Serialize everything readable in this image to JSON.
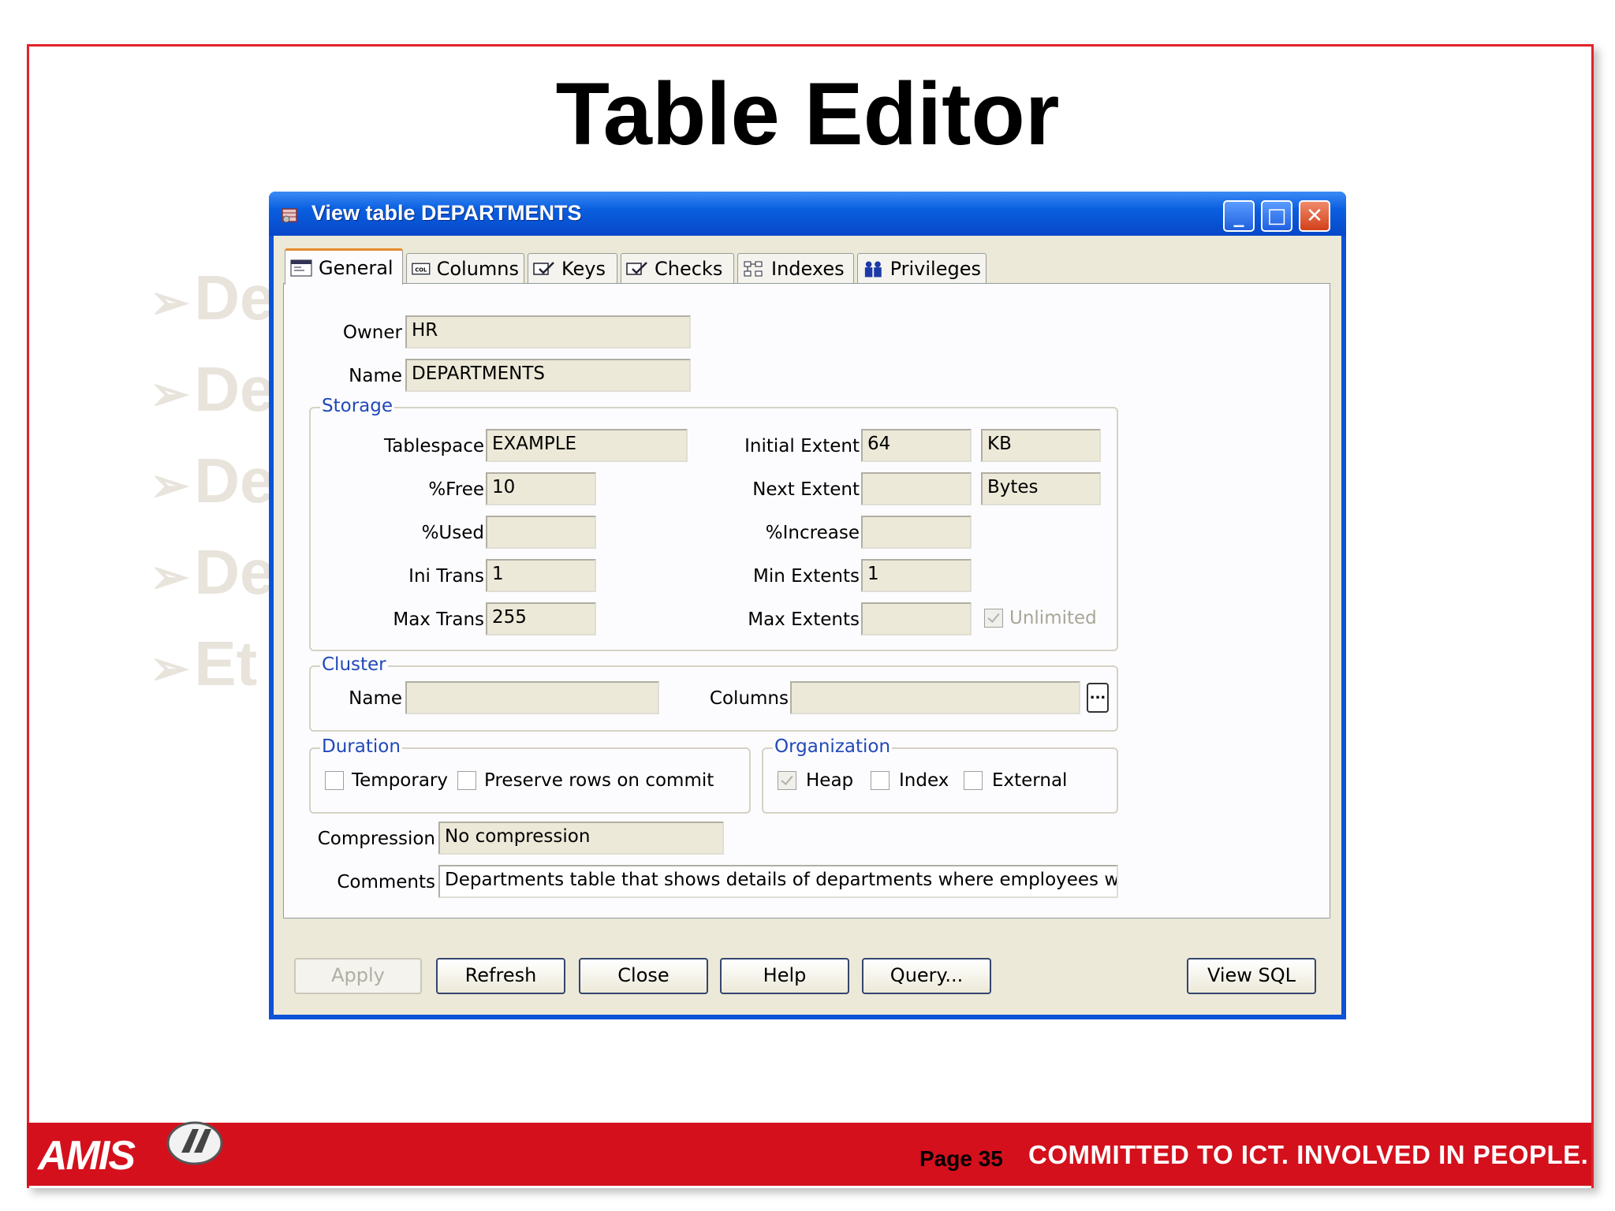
{
  "slide": {
    "title": "Table Editor",
    "background_bullets": [
      "De",
      "De",
      "De",
      "De",
      "Et"
    ],
    "footer": {
      "logo_text": "AMIS",
      "page_label": "Page 35",
      "tagline": "COMMITTED TO ICT.  INVOLVED IN PEOPLE."
    }
  },
  "window": {
    "title": "View table DEPARTMENTS",
    "controls": {
      "minimize": "_",
      "maximize": "□",
      "close": "✕"
    },
    "tabs": [
      {
        "label": "General",
        "icon": "general-icon",
        "active": true
      },
      {
        "label": "Columns",
        "icon": "columns-icon",
        "active": false
      },
      {
        "label": "Keys",
        "icon": "keys-icon",
        "active": false
      },
      {
        "label": "Checks",
        "icon": "checks-icon",
        "active": false
      },
      {
        "label": "Indexes",
        "icon": "indexes-icon",
        "active": false
      },
      {
        "label": "Privileges",
        "icon": "privileges-icon",
        "active": false
      }
    ],
    "general": {
      "owner_label": "Owner",
      "owner_value": "HR",
      "name_label": "Name",
      "name_value": "DEPARTMENTS",
      "storage": {
        "legend": "Storage",
        "tablespace_label": "Tablespace",
        "tablespace_value": "EXAMPLE",
        "free_label": "%Free",
        "free_value": "10",
        "used_label": "%Used",
        "used_value": "",
        "initrans_label": "Ini Trans",
        "initrans_value": "1",
        "maxtrans_label": "Max Trans",
        "maxtrans_value": "255",
        "initial_extent_label": "Initial Extent",
        "initial_extent_value": "64",
        "initial_extent_unit": "KB",
        "next_extent_label": "Next Extent",
        "next_extent_value": "",
        "next_extent_unit": "Bytes",
        "increase_label": "%Increase",
        "increase_value": "",
        "min_extents_label": "Min Extents",
        "min_extents_value": "1",
        "max_extents_label": "Max Extents",
        "max_extents_value": "",
        "unlimited_label": "Unlimited",
        "unlimited_checked": true
      },
      "cluster": {
        "legend": "Cluster",
        "name_label": "Name",
        "name_value": "",
        "columns_label": "Columns",
        "columns_value": "",
        "ellipsis": "..."
      },
      "duration": {
        "legend": "Duration",
        "temporary_label": "Temporary",
        "temporary_checked": false,
        "preserve_label": "Preserve rows on commit",
        "preserve_checked": false
      },
      "organization": {
        "legend": "Organization",
        "heap_label": "Heap",
        "heap_checked": true,
        "index_label": "Index",
        "index_checked": false,
        "external_label": "External",
        "external_checked": false
      },
      "compression_label": "Compression",
      "compression_value": "No compression",
      "comments_label": "Comments",
      "comments_value": "Departments table that shows details of departments where employees work. Contai"
    },
    "buttons": {
      "apply": "Apply",
      "refresh": "Refresh",
      "close": "Close",
      "help": "Help",
      "query": "Query...",
      "view_sql": "View SQL"
    }
  }
}
